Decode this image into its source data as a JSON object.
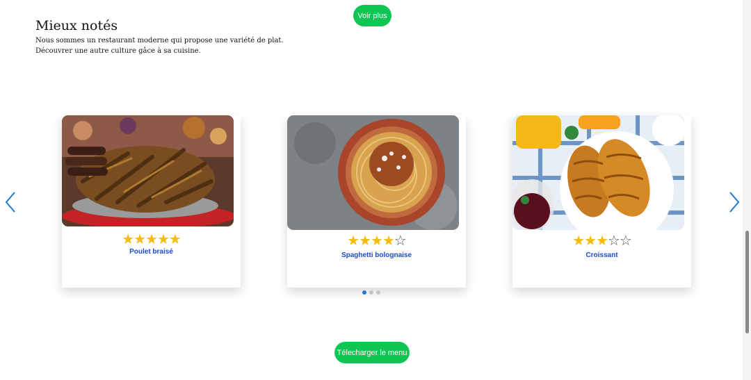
{
  "top_button": {
    "label": "Voir plus"
  },
  "section": {
    "title": "Mieux notés",
    "intro_line1": "Nous sommes un restaurant moderne qui propose une variété de plat.",
    "intro_line2": "Découvrer une autre culture gâce à sa cuisine."
  },
  "dishes": [
    {
      "name": "Poulet braisé",
      "rating": 5,
      "max_rating": 5,
      "photo": "grilled-chicken-platter"
    },
    {
      "name": "Spaghetti bolognaise",
      "rating": 4,
      "max_rating": 5,
      "photo": "spaghetti-bowl"
    },
    {
      "name": "Croissant",
      "rating": 3,
      "max_rating": 5,
      "photo": "croissants-plate"
    }
  ],
  "carousel": {
    "prev_icon": "chevron-left-icon",
    "next_icon": "chevron-right-icon",
    "page_count": 3,
    "active_page": 1,
    "arrow_color": "#1f77d4"
  },
  "bottom_button": {
    "label": "Télecharger le menu"
  },
  "colors": {
    "button_green": "#0fc653",
    "star_gold": "#f5bb0d",
    "dish_name_blue": "#1c4bc7"
  }
}
